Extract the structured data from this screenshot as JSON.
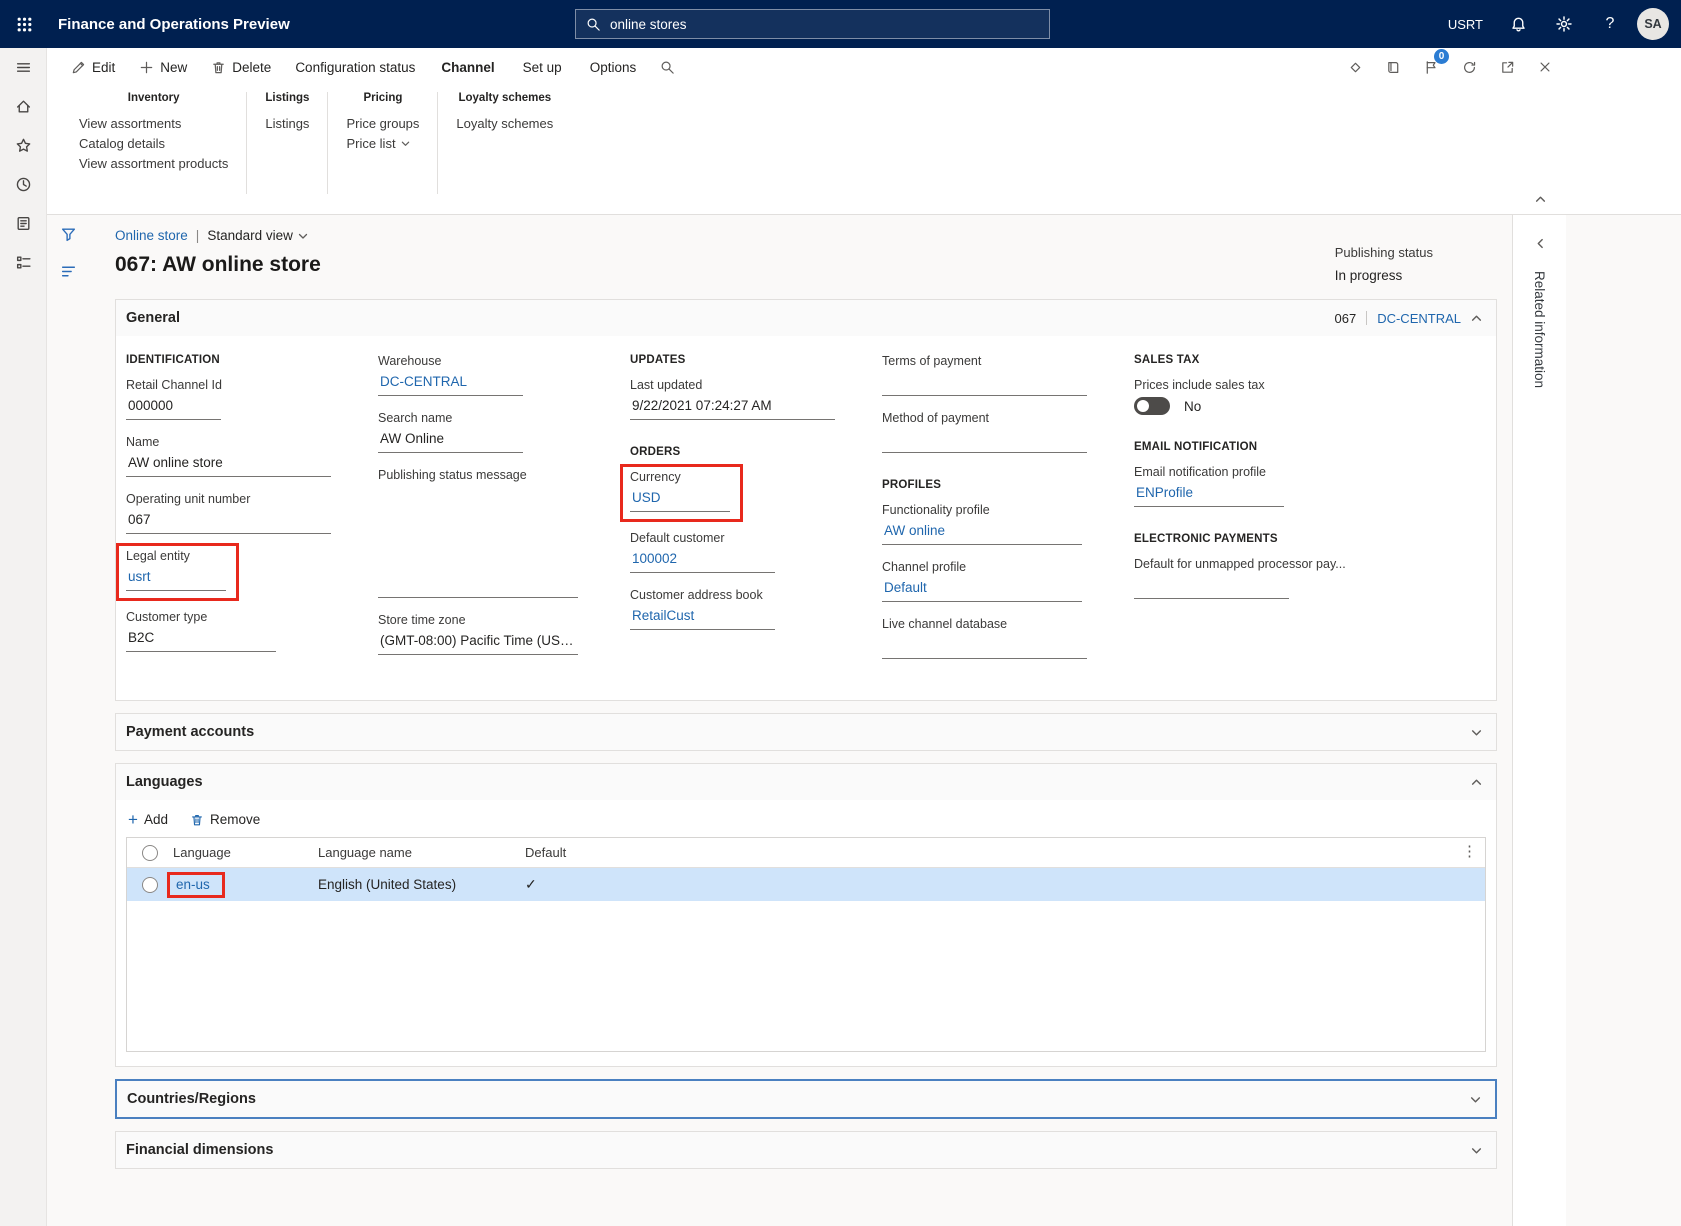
{
  "topbar": {
    "app_title": "Finance and Operations Preview",
    "search_value": "online stores",
    "environment": "USRT",
    "avatar_initials": "SA",
    "help_glyph": "?"
  },
  "action_pane": {
    "edit": "Edit",
    "new": "New",
    "delete": "Delete",
    "configuration_status": "Configuration status",
    "tabs": {
      "channel": "Channel",
      "setup": "Set up",
      "options": "Options"
    },
    "badge_count": "0",
    "groups": {
      "inventory": {
        "title": "Inventory",
        "items": [
          "View assortments",
          "Catalog details",
          "View assortment products"
        ]
      },
      "listings": {
        "title": "Listings",
        "items": [
          "Listings"
        ]
      },
      "pricing": {
        "title": "Pricing",
        "items": [
          "Price groups",
          "Price list"
        ]
      },
      "loyalty": {
        "title": "Loyalty schemes",
        "items": [
          "Loyalty schemes"
        ]
      }
    }
  },
  "page": {
    "breadcrumb": "Online store",
    "separator": "|",
    "view_selector": "Standard view",
    "title": "067: AW online store",
    "publishing_status_label": "Publishing status",
    "publishing_status_value": "In progress",
    "related_information": "Related information"
  },
  "general": {
    "title": "General",
    "header_ref": "067",
    "header_link": "DC-CENTRAL",
    "captions": {
      "identification": "IDENTIFICATION",
      "updates": "UPDATES",
      "orders": "ORDERS",
      "profiles": "PROFILES",
      "sales_tax": "SALES TAX",
      "email_notification": "EMAIL NOTIFICATION",
      "electronic_payments": "ELECTRONIC PAYMENTS"
    },
    "fields": {
      "retail_channel_id": {
        "label": "Retail Channel Id",
        "value": "000000"
      },
      "name": {
        "label": "Name",
        "value": "AW online store"
      },
      "operating_unit_number": {
        "label": "Operating unit number",
        "value": "067"
      },
      "legal_entity": {
        "label": "Legal entity",
        "value": "usrt"
      },
      "customer_type": {
        "label": "Customer type",
        "value": "B2C"
      },
      "warehouse": {
        "label": "Warehouse",
        "value": "DC-CENTRAL"
      },
      "search_name": {
        "label": "Search name",
        "value": "AW Online"
      },
      "publishing_status_message": {
        "label": "Publishing status message",
        "value": ""
      },
      "store_time_zone": {
        "label": "Store time zone",
        "value": "(GMT-08:00) Pacific Time (US & ..."
      },
      "last_updated": {
        "label": "Last updated",
        "value": "9/22/2021 07:24:27 AM"
      },
      "currency": {
        "label": "Currency",
        "value": "USD"
      },
      "default_customer": {
        "label": "Default customer",
        "value": "100002"
      },
      "customer_address_book": {
        "label": "Customer address book",
        "value": "RetailCust"
      },
      "terms_of_payment": {
        "label": "Terms of payment",
        "value": ""
      },
      "method_of_payment": {
        "label": "Method of payment",
        "value": ""
      },
      "functionality_profile": {
        "label": "Functionality profile",
        "value": "AW online"
      },
      "channel_profile": {
        "label": "Channel profile",
        "value": "Default"
      },
      "live_channel_database": {
        "label": "Live channel database",
        "value": ""
      },
      "prices_include_sales_tax": {
        "label": "Prices include sales tax",
        "value": "No"
      },
      "email_notification_profile": {
        "label": "Email notification profile",
        "value": "ENProfile"
      },
      "electronic_payments_default": {
        "label": "Default for unmapped processor pay...",
        "value": ""
      }
    }
  },
  "payment_accounts": {
    "title": "Payment accounts"
  },
  "languages": {
    "title": "Languages",
    "add": "Add",
    "remove": "Remove",
    "columns": {
      "language": "Language",
      "language_name": "Language name",
      "default": "Default"
    },
    "row": {
      "language": "en-us",
      "language_name": "English (United States)",
      "default_check": "✓"
    },
    "more_glyph": "⋮"
  },
  "countries_regions": {
    "title": "Countries/Regions"
  },
  "financial_dimensions": {
    "title": "Financial dimensions"
  }
}
